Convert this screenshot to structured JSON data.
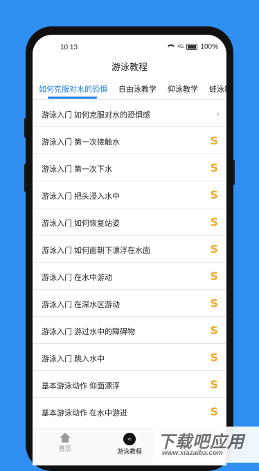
{
  "status": {
    "time": "10:13",
    "signal": "4G",
    "battery": "100%"
  },
  "title": "游泳教程",
  "tabs": [
    {
      "label": "如何克服对水的恐惧"
    },
    {
      "label": "自由泳教学"
    },
    {
      "label": "仰泳教学"
    },
    {
      "label": "蛙泳教学"
    }
  ],
  "rows": [
    {
      "label": "游泳入门 如何克服对水的恐惧感",
      "icon": "chevron-right-icon"
    },
    {
      "label": "游泳入门 第一次接触水",
      "icon": "s-icon"
    },
    {
      "label": "游泳入门 第一次下水",
      "icon": "s-icon"
    },
    {
      "label": "游泳入门 把头浸入水中",
      "icon": "s-icon"
    },
    {
      "label": "游泳入门 如何恢复站姿",
      "icon": "s-icon"
    },
    {
      "label": "游泳入门 如何面朝下漂浮在水面",
      "icon": "s-icon"
    },
    {
      "label": "游泳入门 在水中游动",
      "icon": "s-icon"
    },
    {
      "label": "游泳入门 在深水区游动",
      "icon": "s-icon"
    },
    {
      "label": "游泳入门 游过水中的障碍物",
      "icon": "s-icon"
    },
    {
      "label": "游泳入门 跳入水中",
      "icon": "s-icon"
    },
    {
      "label": "基本游泳动作 仰面漂浮",
      "icon": "s-icon"
    },
    {
      "label": "基本游泳动作 在水中游进",
      "icon": "s-icon"
    }
  ],
  "nav": {
    "home": "首页",
    "swim": "游泳教程"
  },
  "watermark": {
    "big": "下载吧应用",
    "small": "www.xiazaiba.com"
  },
  "colors": {
    "accent": "#1f7be0",
    "badge": "#f4a921",
    "background": "#2f8ff0"
  }
}
